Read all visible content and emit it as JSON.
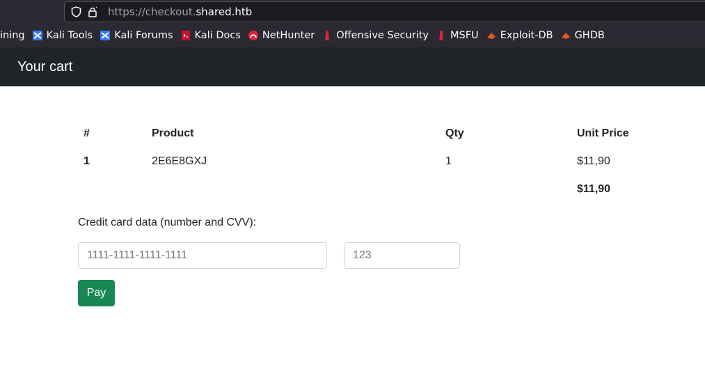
{
  "browser": {
    "url_prefix": "https://checkout.",
    "url_domain": "shared.htb",
    "bookmarks": [
      {
        "label": "ining",
        "icon": "none"
      },
      {
        "label": "Kali Tools",
        "icon": "kali-dragon-icon"
      },
      {
        "label": "Kali Forums",
        "icon": "kali-dragon-icon"
      },
      {
        "label": "Kali Docs",
        "icon": "kali-docs-icon"
      },
      {
        "label": "NetHunter",
        "icon": "nethunter-icon"
      },
      {
        "label": "Offensive Security",
        "icon": "offsec-icon"
      },
      {
        "label": "MSFU",
        "icon": "offsec-icon"
      },
      {
        "label": "Exploit-DB",
        "icon": "exploitdb-icon"
      },
      {
        "label": "GHDB",
        "icon": "exploitdb-icon"
      }
    ]
  },
  "navbar": {
    "title": "Your cart"
  },
  "cart": {
    "headers": [
      "#",
      "Product",
      "Qty",
      "Unit Price"
    ],
    "rows": [
      {
        "num": "1",
        "product": "2E6E8GXJ",
        "qty": "1",
        "price": "$11,90"
      }
    ],
    "total": "$11,90"
  },
  "payment": {
    "label": "Credit card data (number and CVV):",
    "card_placeholder": "1111-1111-1111-1111",
    "cvv_placeholder": "123",
    "pay_label": "Pay"
  },
  "colors": {
    "navbar": "#212529",
    "pay_button": "#198754"
  }
}
